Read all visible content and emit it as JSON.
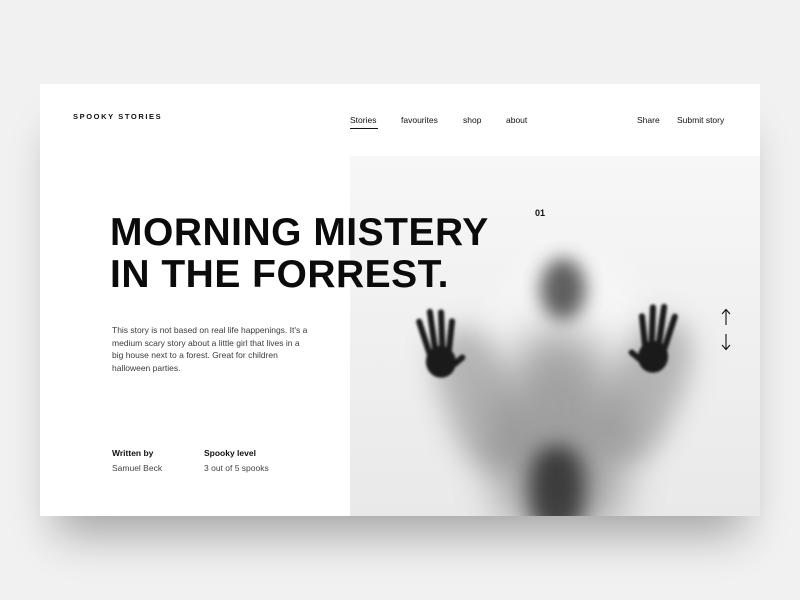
{
  "header": {
    "brand": "SPOOKY STORIES",
    "nav": [
      {
        "label": "Stories",
        "active": true
      },
      {
        "label": "favourites",
        "active": false
      },
      {
        "label": "shop",
        "active": false
      },
      {
        "label": "about",
        "active": false
      }
    ],
    "actions": {
      "share": "Share",
      "submit": "Submit story"
    }
  },
  "hero": {
    "title_line_1": "MORNING MISTERY",
    "title_line_2": "IN THE FORREST.",
    "index": "01",
    "description": "This story is not based on real life happenings. It's a medium scary story about a little girl that lives in a big house next to a forest. Great for children halloween parties."
  },
  "meta": {
    "written_by_label": "Written by",
    "written_by_value": "Samuel Beck",
    "spooky_label": "Spooky level",
    "spooky_value": "3 out of 5 spooks"
  },
  "controls": {
    "up_icon": "arrow-up-icon",
    "down_icon": "arrow-down-icon"
  },
  "image": {
    "subject": "blurred-figure-behind-frosted-glass"
  },
  "colors": {
    "background": "#f1f1f1",
    "card": "#ffffff",
    "text": "#111111"
  }
}
